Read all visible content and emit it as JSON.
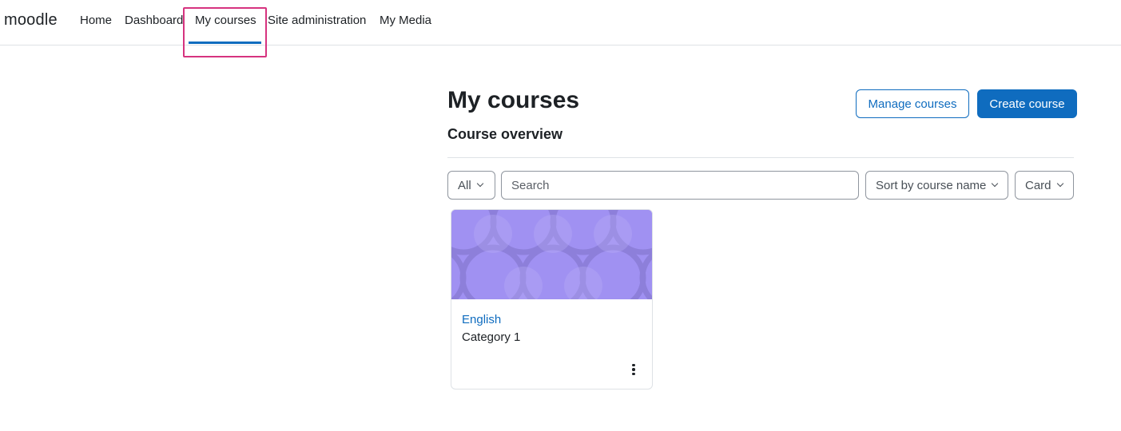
{
  "brand": "moodle",
  "nav": {
    "home": "Home",
    "dashboard": "Dashboard",
    "my_courses": "My courses",
    "site_administration": "Site administration",
    "my_media": "My Media"
  },
  "page": {
    "title": "My courses",
    "manage_courses": "Manage courses",
    "create_course": "Create course",
    "section_title": "Course overview"
  },
  "filters": {
    "grouping": "All",
    "search_placeholder": "Search",
    "sort": "Sort by course name",
    "view": "Card"
  },
  "courses": [
    {
      "name": "English",
      "category": "Category 1"
    }
  ],
  "colors": {
    "primary": "#0f6cbf",
    "highlight": "#d6337f",
    "course_image": "#a091f2"
  },
  "icons": {
    "dropdown": "chevron-down-icon",
    "course_menu": "kebab-menu-icon"
  }
}
